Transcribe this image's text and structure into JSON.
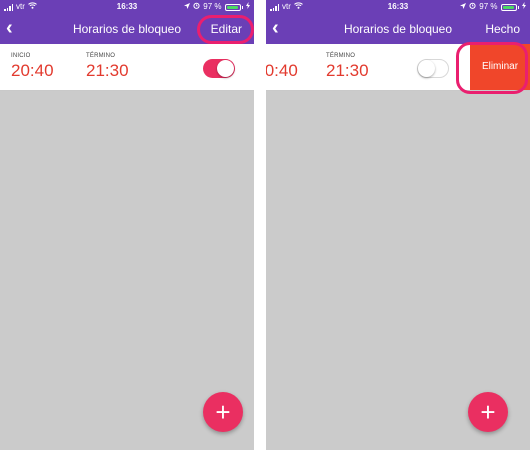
{
  "status_bar": {
    "carrier": "vtr",
    "time": "16:33",
    "battery_percent": "97 %",
    "icons": [
      "signal-icon",
      "wifi-icon",
      "location-arrow-icon",
      "alarm-icon",
      "battery-icon",
      "charging-icon"
    ]
  },
  "nav": {
    "back_icon": "‹",
    "title": "Horarios de bloqueo"
  },
  "screens": {
    "left": {
      "action_label": "Editar",
      "schedule": {
        "start_label": "INICIO",
        "start_time": "20:40",
        "end_label": "TÉRMINO",
        "end_time": "21:30",
        "enabled": true
      },
      "fab_label": "+"
    },
    "right": {
      "action_label": "Hecho",
      "schedule": {
        "start_time_partial": ":0:40",
        "end_label": "TÉRMINO",
        "end_time": "21:30",
        "enabled": false
      },
      "delete_label": "Eliminar",
      "fab_label": "+"
    }
  },
  "colors": {
    "header": "#6b3fb6",
    "accent": "#ea2f61",
    "time_text": "#e23a2e",
    "delete": "#f0462a",
    "background": "#cbcbcb",
    "highlight": "#ea1f6f"
  }
}
